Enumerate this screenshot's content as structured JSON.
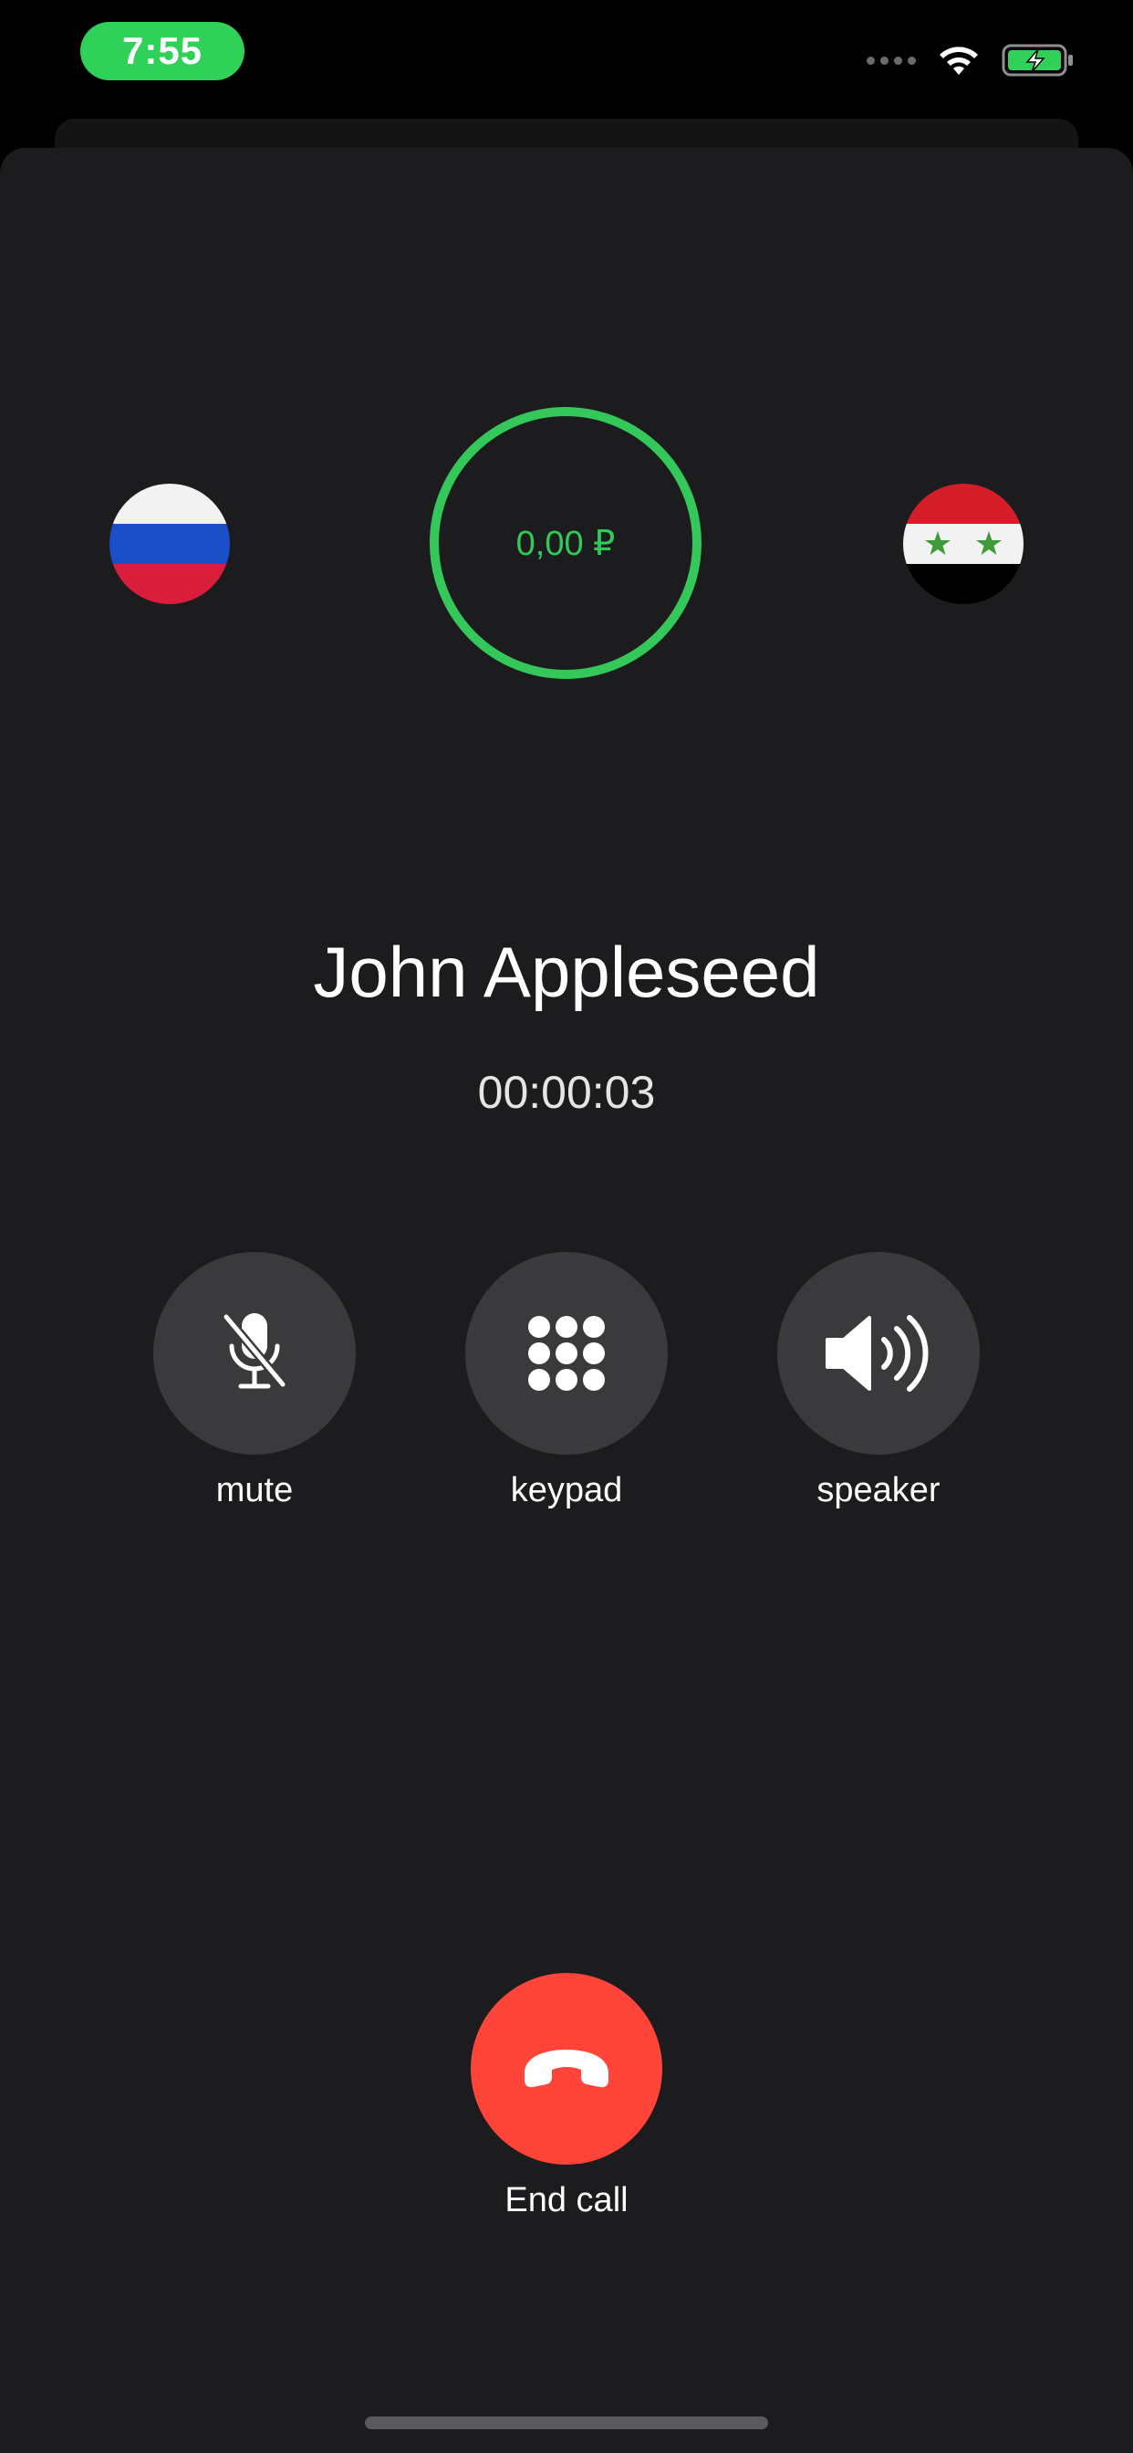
{
  "status_bar": {
    "time": "7:55",
    "icons": [
      "signal-dots-icon",
      "wifi-icon",
      "battery-charging-icon"
    ]
  },
  "balance": {
    "amount": "0,00 ₽",
    "ring_color": "#34c759"
  },
  "flags": {
    "origin": "russia-flag",
    "destination": "syria-flag"
  },
  "call": {
    "caller_name": "John Appleseed",
    "duration": "00:00:03"
  },
  "controls": [
    {
      "label": "mute",
      "icon": "mic-slash-icon"
    },
    {
      "label": "keypad",
      "icon": "keypad-icon"
    },
    {
      "label": "speaker",
      "icon": "speaker-wave-icon"
    }
  ],
  "end_call": {
    "label": "End call",
    "icon": "phone-down-icon",
    "color": "#ff453a"
  },
  "colors": {
    "accent_green": "#2fd158",
    "background": "#1c1c1e",
    "control_bg": "#3a3a3c"
  }
}
